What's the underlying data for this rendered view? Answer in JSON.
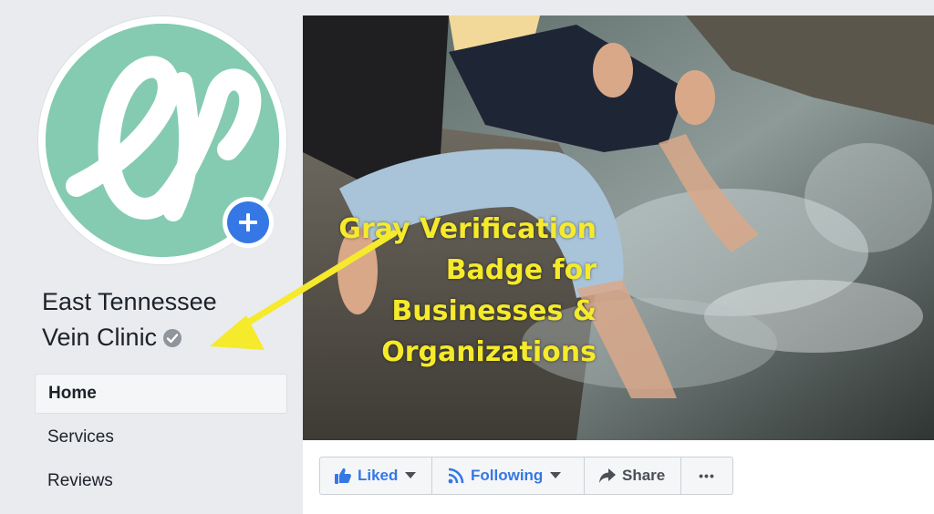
{
  "page": {
    "name_line1": "East Tennessee",
    "name_line2": "Vein Clinic"
  },
  "nav": {
    "items": [
      {
        "label": "Home"
      },
      {
        "label": "Services"
      },
      {
        "label": "Reviews"
      }
    ]
  },
  "annotation": {
    "lines": [
      "Gray Verification",
      "Badge for",
      "Businesses &",
      "Organizations"
    ],
    "color": "#f5ea2b"
  },
  "actions": {
    "liked": "Liked",
    "following": "Following",
    "share": "Share",
    "more": "•••"
  },
  "colors": {
    "background": "#e9ebee",
    "avatar_teal": "#84cbb1",
    "accent_blue": "#3578e5",
    "badge_gray": "#90949c"
  },
  "icons": {
    "avatar_logo": "cursive-letter-e-logo",
    "add_photo": "plus-icon",
    "verify": "check-badge-icon",
    "liked": "thumbs-up-icon",
    "following": "rss-icon",
    "share": "share-arrow-icon"
  }
}
